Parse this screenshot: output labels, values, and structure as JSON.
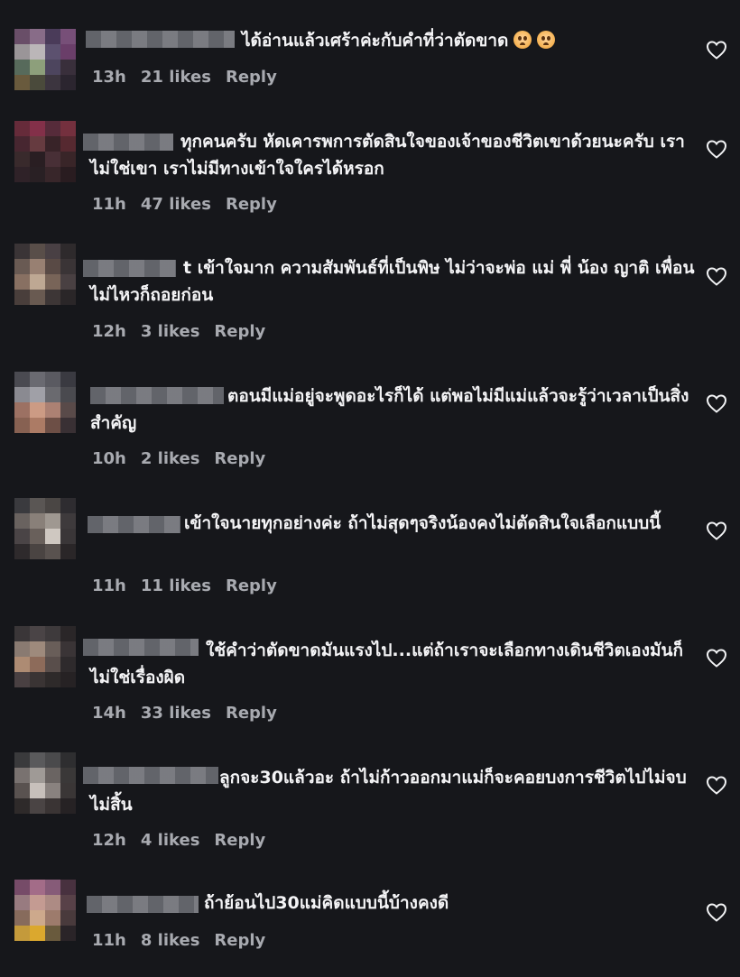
{
  "comments": [
    {
      "text": "ได้อ่านแล้วเศร้าค่ะกับคำที่ว่าตัดขาด",
      "emojis": 2,
      "time": "13h",
      "likes": "21 likes",
      "reply": "Reply"
    },
    {
      "text": "ทุกคนครับ หัดเคารพการตัดสินใจของเจ้าของชีวิตเขาด้วยนะครับ เราไม่ใช่เขา เราไม่มีทางเข้าใจใครได้หรอก",
      "time": "11h",
      "likes": "47 likes",
      "reply": "Reply"
    },
    {
      "text": "t เข้าใจมาก ความสัมพันธ์ที่เป็นพิษ ไม่ว่าจะพ่อ แม่ พี่ น้อง ญาติ เพื่อน ไม่ไหวก็ถอยก่อน",
      "time": "12h",
      "likes": "3 likes",
      "reply": "Reply"
    },
    {
      "text": "ตอนมีแม่อยู่จะพูดอะไรก็ได้ แต่พอไม่มีแม่แล้วจะรู้ว่าเวลาเป็นสิ่งสำคัญ",
      "time": "10h",
      "likes": "2 likes",
      "reply": "Reply"
    },
    {
      "text": "เข้าใจนายทุกอย่างค่ะ ถ้าไม่สุดๆจริงน้องคงไม่ตัดสินใจเลือกแบบนี้",
      "time": "11h",
      "likes": "11 likes",
      "reply": "Reply"
    },
    {
      "text": "ใช้คำว่าตัดขาดมันแรงไป...แต่ถ้าเราจะเลือกทางเดินชีวิตเองมันก็ไม่ใช่เรื่องผิด",
      "time": "14h",
      "likes": "33 likes",
      "reply": "Reply"
    },
    {
      "text": "ลูกจะ30แล้วอะ ถ้าไม่ก้าวออกมาแม่ก็จะคอยบงการชีวิตไปไม่จบไม่สิ้น",
      "time": "12h",
      "likes": "4 likes",
      "reply": "Reply"
    },
    {
      "text": "ถ้าย้อนไป30แม่คิดแบบนี้บ้างคงดี",
      "time": "11h",
      "likes": "8 likes",
      "reply": "Reply"
    }
  ],
  "icons": {
    "like": "heart-outline-icon",
    "emoji": "pleading-face-emoji"
  },
  "colors": {
    "background": "#16171b",
    "text": "#f4f4f6",
    "meta": "#a8aab0"
  }
}
